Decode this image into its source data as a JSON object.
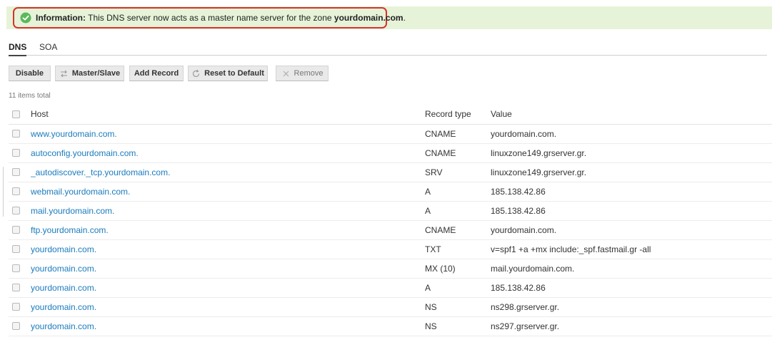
{
  "notification": {
    "label": "Information:",
    "text_before": " This DNS server now acts as a master name server for the zone ",
    "zone": "yourdomain.com",
    "text_after": "."
  },
  "tabs": [
    {
      "label": "DNS",
      "active": true
    },
    {
      "label": "SOA",
      "active": false
    }
  ],
  "toolbar": {
    "disable": "Disable",
    "master_slave": "Master/Slave",
    "add_record": "Add Record",
    "reset": "Reset to Default",
    "remove": "Remove"
  },
  "items_total": "11 items total",
  "table": {
    "headers": {
      "host": "Host",
      "type": "Record type",
      "value": "Value"
    },
    "rows": [
      {
        "host": "www.yourdomain.com.",
        "type": "CNAME",
        "value": "yourdomain.com."
      },
      {
        "host": "autoconfig.yourdomain.com.",
        "type": "CNAME",
        "value": "linuxzone149.grserver.gr."
      },
      {
        "host": "_autodiscover._tcp.yourdomain.com.",
        "type": "SRV",
        "value": "linuxzone149.grserver.gr."
      },
      {
        "host": "webmail.yourdomain.com.",
        "type": "A",
        "value": "185.138.42.86"
      },
      {
        "host": "mail.yourdomain.com.",
        "type": "A",
        "value": "185.138.42.86"
      },
      {
        "host": "ftp.yourdomain.com.",
        "type": "CNAME",
        "value": "yourdomain.com."
      },
      {
        "host": "yourdomain.com.",
        "type": "TXT",
        "value": "v=spf1 +a +mx include:_spf.fastmail.gr -all"
      },
      {
        "host": "yourdomain.com.",
        "type": "MX (10)",
        "value": "mail.yourdomain.com."
      },
      {
        "host": "yourdomain.com.",
        "type": "A",
        "value": "185.138.42.86"
      },
      {
        "host": "yourdomain.com.",
        "type": "NS",
        "value": "ns298.grserver.gr."
      },
      {
        "host": "yourdomain.com.",
        "type": "NS",
        "value": "ns297.grserver.gr."
      }
    ]
  },
  "colors": {
    "accent_link": "#1a7bbd",
    "success": "#5cb85c",
    "highlight_border": "#d9332b"
  }
}
